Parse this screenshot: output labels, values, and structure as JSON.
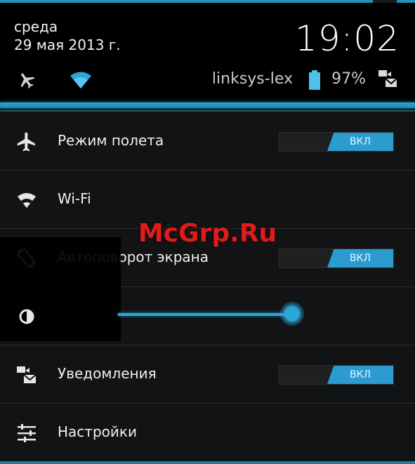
{
  "header": {
    "day": "среда",
    "date": "29 мая 2013 г.",
    "time": "19:02",
    "ssid": "linksys-lex",
    "battery_percent": "97%"
  },
  "quick_settings": {
    "airplane_mode": {
      "label": "Режим полета",
      "toggle": "ВКЛ"
    },
    "wifi": {
      "label": "Wi-Fi"
    },
    "autorotate": {
      "label": "Автоповорот экрана",
      "toggle": "ВКЛ"
    },
    "brightness": {
      "level": 0.75
    },
    "notifications": {
      "label": "Уведомления",
      "toggle": "ВКЛ"
    },
    "settings": {
      "label": "Настройки"
    }
  },
  "watermark": "McGrp.Ru",
  "colors": {
    "accent": "#2aa7d8",
    "toggle_on": "#2b9bd0",
    "background": "#121314",
    "watermark": "#e11a1a"
  }
}
